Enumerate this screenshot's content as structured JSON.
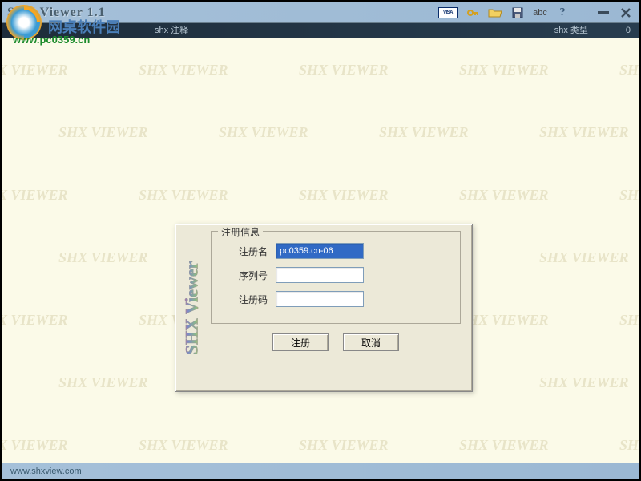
{
  "window": {
    "title": "SHX Viewer 1.1",
    "toolbar": {
      "visa_label": "VISA",
      "abc_label": "abc"
    },
    "infobar": {
      "annotation_label": "shx 注释",
      "type_label": "shx 类型",
      "count": "0"
    },
    "statusbar": {
      "url": "www.shxview.com"
    }
  },
  "overlay": {
    "brand": "网桌软件园",
    "url": "www.pc0359.cn"
  },
  "watermark": "SHX VIEWER",
  "dialog": {
    "logo_text": "SHX Viewer",
    "fieldset_title": "注册信息",
    "rows": {
      "name_label": "注册名",
      "name_value": "pc0359.cn-06",
      "serial_label": "序列号",
      "serial_value": "",
      "code_label": "注册码",
      "code_value": ""
    },
    "buttons": {
      "register": "注册",
      "cancel": "取消"
    }
  }
}
